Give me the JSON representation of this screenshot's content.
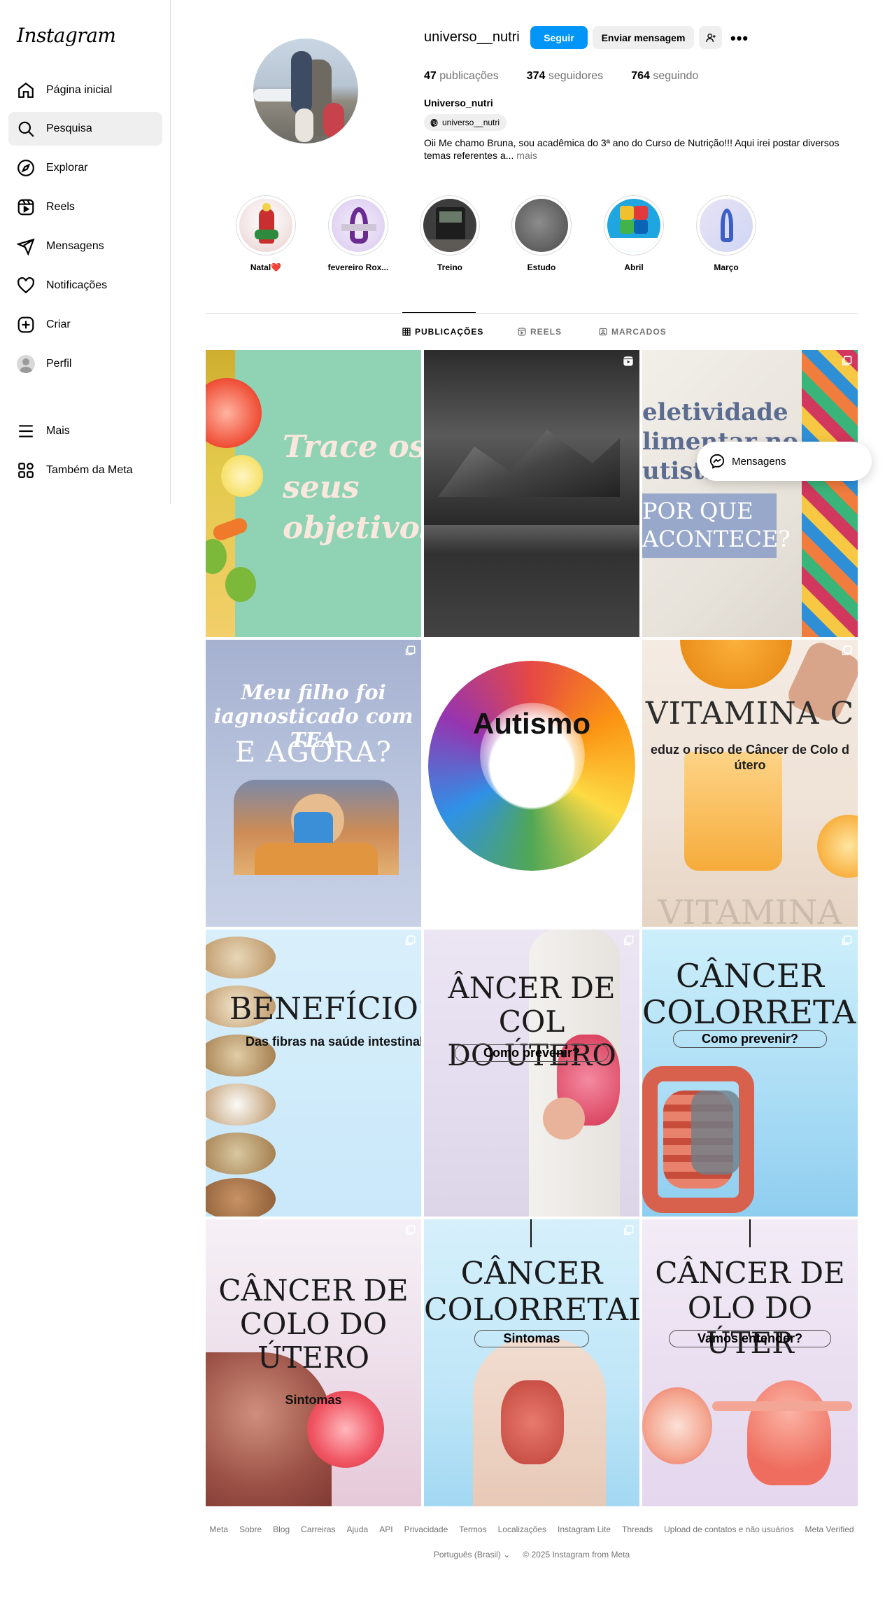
{
  "app": {
    "logo": "Instagram"
  },
  "sidebar": {
    "items": [
      {
        "label": "Página inicial",
        "icon": "home-icon"
      },
      {
        "label": "Pesquisa",
        "icon": "search-icon",
        "active": true
      },
      {
        "label": "Explorar",
        "icon": "compass-icon"
      },
      {
        "label": "Reels",
        "icon": "reels-icon"
      },
      {
        "label": "Mensagens",
        "icon": "messenger-icon"
      },
      {
        "label": "Notificações",
        "icon": "heart-icon"
      },
      {
        "label": "Criar",
        "icon": "plus-square-icon"
      },
      {
        "label": "Perfil",
        "icon": "avatar"
      }
    ],
    "more": "Mais",
    "meta": "Também da Meta"
  },
  "profile": {
    "username": "universo__nutri",
    "follow_label": "Seguir",
    "message_label": "Enviar mensagem",
    "posts_count": "47",
    "posts_label": "publicações",
    "followers_count": "374",
    "followers_label": "seguidores",
    "following_count": "764",
    "following_label": "seguindo",
    "full_name": "Universo_nutri",
    "threads_handle": "universo__nutri",
    "bio": "Oii Me chamo Bruna, sou acadêmica do 3ª ano do Curso de Nutrição!!! Aqui irei postar diversos temas referentes a...",
    "bio_more": " mais"
  },
  "highlights": [
    {
      "label": "Natal❤️"
    },
    {
      "label": "fevereiro Rox..."
    },
    {
      "label": "Treino"
    },
    {
      "label": "Estudo"
    },
    {
      "label": "Abril"
    },
    {
      "label": "Março"
    }
  ],
  "tabs": [
    {
      "label": "PUBLICAÇÕES",
      "active": true
    },
    {
      "label": "REELS"
    },
    {
      "label": "MARCADOS"
    }
  ],
  "posts": {
    "p1_text": "Trace os seus objetivos",
    "p3_line1": "eletividade",
    "p3_line2": "limentar no",
    "p3_line3": "utista",
    "p3_line4": "POR QUE",
    "p3_line5": "ACONTECE?",
    "p4_line1": "Meu filho foi",
    "p4_line2": "iagnosticado com TEA",
    "p4_line3": "E AGORA?",
    "p5_text": "Autismo",
    "p6_title": "VITAMINA C",
    "p6_sub": "eduz o risco de Câncer de Colo d útero",
    "p6_watermark": "VITAMINA",
    "p7_title": "BENEFÍCIOS",
    "p7_sub": "Das fibras na saúde intestinal",
    "p8_line1": "ÂNCER DE COL",
    "p8_line2": "DO ÚTERO",
    "p8_pill": "Como prevenir?",
    "p9_line1": "CÂNCER",
    "p9_line2": "COLORRETAL",
    "p9_pill": "Como prevenir?",
    "p10_line1": "CÂNCER DE",
    "p10_line2": "COLO DO",
    "p10_line3": "ÚTERO",
    "p10_sub": "Sintomas",
    "p11_line1": "CÂNCER",
    "p11_line2": "COLORRETAL",
    "p11_pill": "Sintomas",
    "p12_line1": "CÂNCER DE",
    "p12_line2": "OLO DO ÚTER",
    "p12_pill": "Vamos entender?"
  },
  "floating_messages": "Mensagens",
  "footer": {
    "links": [
      "Meta",
      "Sobre",
      "Blog",
      "Carreiras",
      "Ajuda",
      "API",
      "Privacidade",
      "Termos",
      "Localizações",
      "Instagram Lite",
      "Threads",
      "Upload de contatos e não usuários",
      "Meta Verified"
    ],
    "language": "Português (Brasil)",
    "copyright": "© 2025 Instagram from Meta"
  },
  "colors": {
    "accent": "#0095f6",
    "muted": "#737373",
    "border": "#dbdbdb"
  }
}
